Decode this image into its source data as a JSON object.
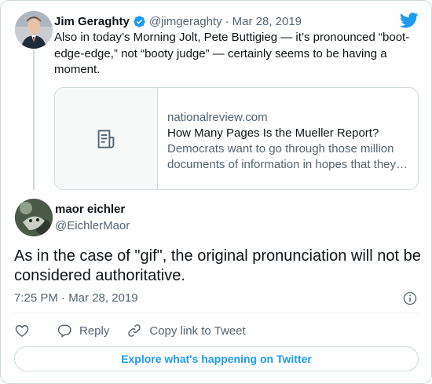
{
  "parent_tweet": {
    "author_name": "Jim Geraghty",
    "handle": "@jimgeraghty",
    "separator": "·",
    "date": "Mar 28, 2019",
    "text": "Also in today’s Morning Jolt, Pete Buttigieg — it’s pronounced “boot-edge-edge,” not “booty judge” — certainly seems to be having a moment.",
    "link_card": {
      "domain": "nationalreview.com",
      "title": "How Many Pages Is the Mueller Report?",
      "description": "Democrats want to go through those million documents of information in hopes that they…",
      "thumbnail_icon": "document-icon"
    }
  },
  "reply_tweet": {
    "author_name": "maor eichler",
    "handle": "@EichlerMaor",
    "text": "As in the case of \"gif\", the original pronunciation will not be considered authoritative.",
    "timestamp": "7:25 PM · Mar 28, 2019"
  },
  "actions": {
    "like_icon": "heart-icon",
    "reply_label": "Reply",
    "copy_link_label": "Copy link to Tweet"
  },
  "explore_button": "Explore what's happening on Twitter",
  "colors": {
    "accent": "#1d9bf0",
    "text": "#0f1419",
    "secondary_text": "#536471",
    "border": "#cfd9de"
  }
}
